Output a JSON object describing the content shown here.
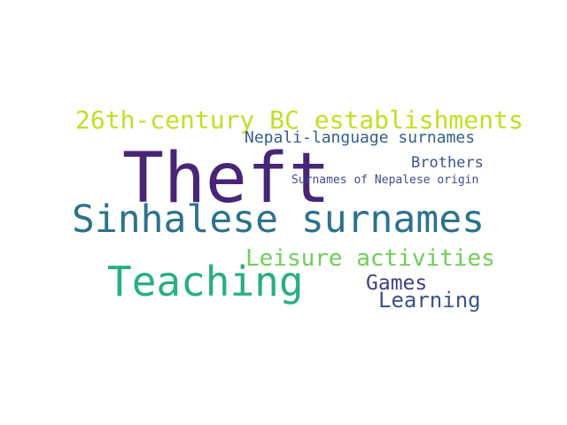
{
  "words": [
    {
      "text": "26th-century BC establishments",
      "color": "#c2df23"
    },
    {
      "text": "Nepali-language surnames",
      "color": "#355f8d"
    },
    {
      "text": "Theft",
      "color": "#482677"
    },
    {
      "text": "Brothers",
      "color": "#3b528b"
    },
    {
      "text": "Surnames of Nepalese origin",
      "color": "#3e4c8a"
    },
    {
      "text": "Sinhalese surnames",
      "color": "#2c728e"
    },
    {
      "text": "Leisure activities",
      "color": "#6ece58"
    },
    {
      "text": "Teaching",
      "color": "#29af7f"
    },
    {
      "text": "Games",
      "color": "#433e85"
    },
    {
      "text": "Learning",
      "color": "#3b528b"
    }
  ]
}
